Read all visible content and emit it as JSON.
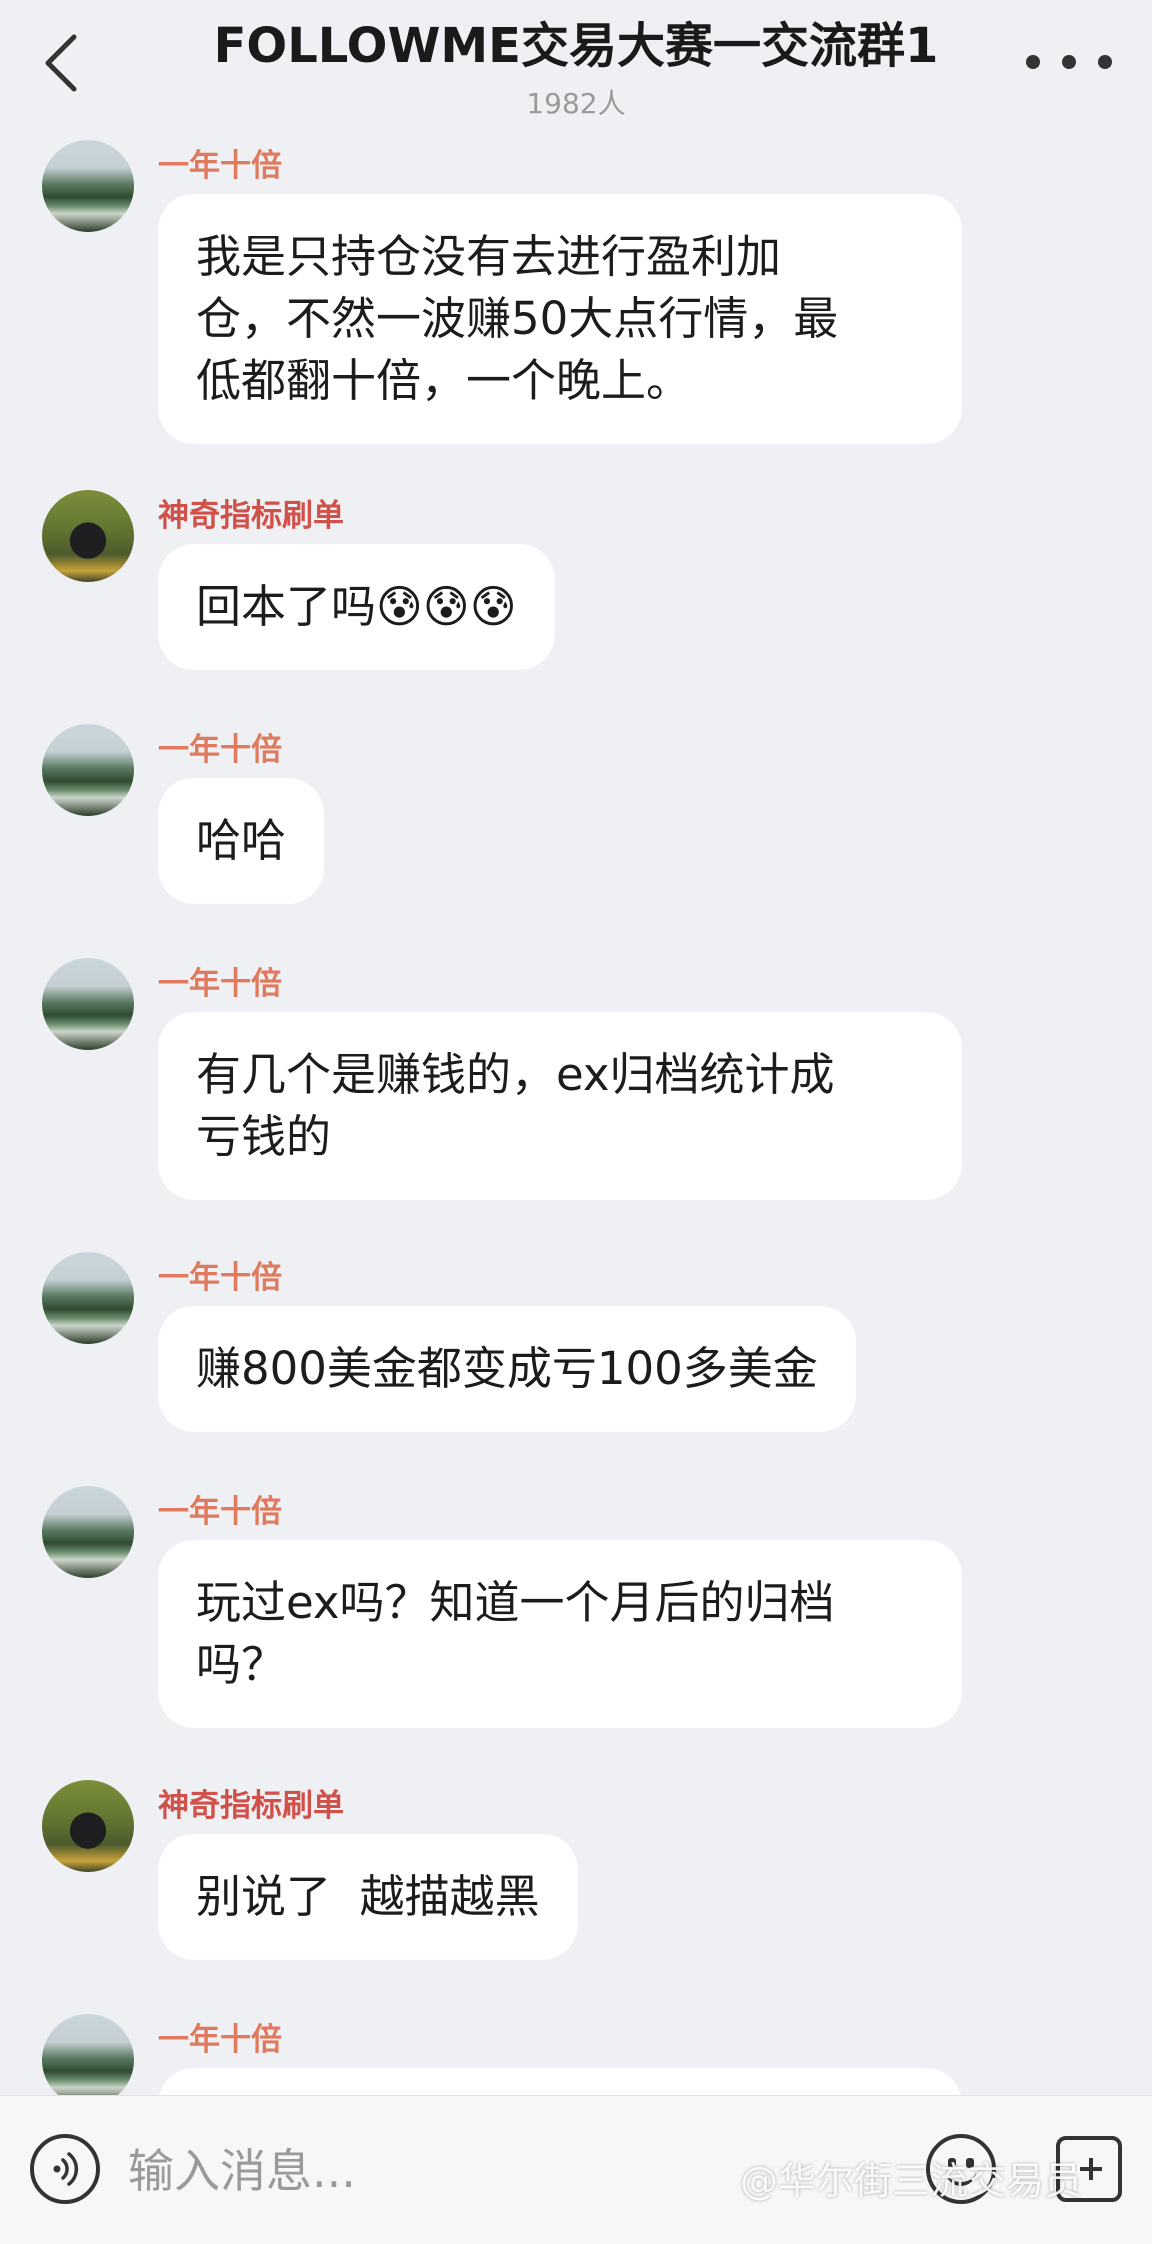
{
  "header": {
    "title": "FOLLOWME交易大赛一交流群1",
    "member_count": "1982人"
  },
  "messages": [
    {
      "sender": "一年十倍",
      "avatar": "mountain-avatar",
      "lines": [
        "我是只持仓没有去进行盈利加",
        "仓，不然一波赚50大点行情，最",
        "低都翻十倍，一个晚上。"
      ]
    },
    {
      "sender": "神奇指标刷单",
      "avatar": "motorcycle-avatar",
      "lines": [
        "回本了吗😰😰😰"
      ]
    },
    {
      "sender": "一年十倍",
      "avatar": "mountain-avatar",
      "lines": [
        "哈哈"
      ]
    },
    {
      "sender": "一年十倍",
      "avatar": "mountain-avatar",
      "lines": [
        "有几个是赚钱的，ex归档统计成",
        "亏钱的"
      ]
    },
    {
      "sender": "一年十倍",
      "avatar": "mountain-avatar",
      "lines": [
        "赚800美金都变成亏100多美金"
      ]
    },
    {
      "sender": "一年十倍",
      "avatar": "mountain-avatar",
      "lines": [
        "玩过ex吗？知道一个月后的归档",
        "吗？"
      ]
    },
    {
      "sender": "神奇指标刷单",
      "avatar": "motorcycle-avatar",
      "lines": [
        "别说了  越描越黑"
      ]
    },
    {
      "sender": "一年十倍",
      "avatar": "mountain-avatar",
      "lines": [
        ""
      ]
    }
  ],
  "input": {
    "placeholder": "输入消息..."
  },
  "watermark": "@华尔街三流交易员",
  "colors": {
    "sender_primary": "#e07a5f",
    "sender_secondary": "#d0504a",
    "background": "#eff0f3",
    "bubble": "#ffffff"
  }
}
